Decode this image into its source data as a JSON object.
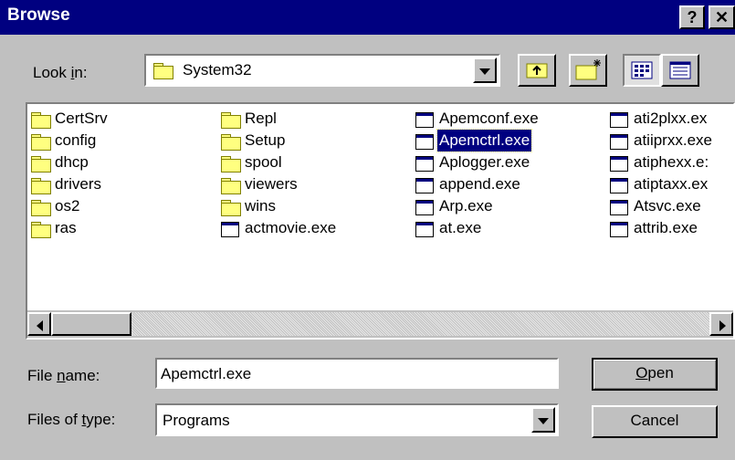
{
  "window": {
    "title": "Browse",
    "help_glyph": "?",
    "close_glyph": "✕"
  },
  "look_in": {
    "label_pre": "Look ",
    "label_accel": "i",
    "label_post": "n:",
    "value": "System32"
  },
  "toolbar": {
    "up_icon": "up-folder-icon",
    "new_folder_icon": "new-folder-icon",
    "list_icon": "list-view-icon",
    "details_icon": "details-view-icon"
  },
  "files": {
    "col1": [
      "CertSrv",
      "config",
      "dhcp",
      "drivers",
      "os2",
      "ras"
    ],
    "col2": [
      "Repl",
      "Setup",
      "spool",
      "viewers",
      "wins",
      "actmovie.exe"
    ],
    "col3": [
      "Apemconf.exe",
      "Apemctrl.exe",
      "Aplogger.exe",
      "append.exe",
      "Arp.exe",
      "at.exe"
    ],
    "col4": [
      "ati2plxx.ex",
      "atiiprxx.exe",
      "atiphexx.e:",
      "atiptaxx.ex",
      "Atsvc.exe",
      "attrib.exe"
    ],
    "selected": "Apemctrl.exe"
  },
  "file_name": {
    "label_pre": "File ",
    "label_accel": "n",
    "label_post": "ame:",
    "value": "Apemctrl.exe"
  },
  "files_of_type": {
    "label_pre": "Files of ",
    "label_accel": "t",
    "label_post": "ype:",
    "value": "Programs"
  },
  "buttons": {
    "open_accel": "O",
    "open_rest": "pen",
    "cancel": "Cancel"
  },
  "colors": {
    "titlebar": "#000080",
    "face": "#c0c0c0",
    "selection": "#000080"
  }
}
